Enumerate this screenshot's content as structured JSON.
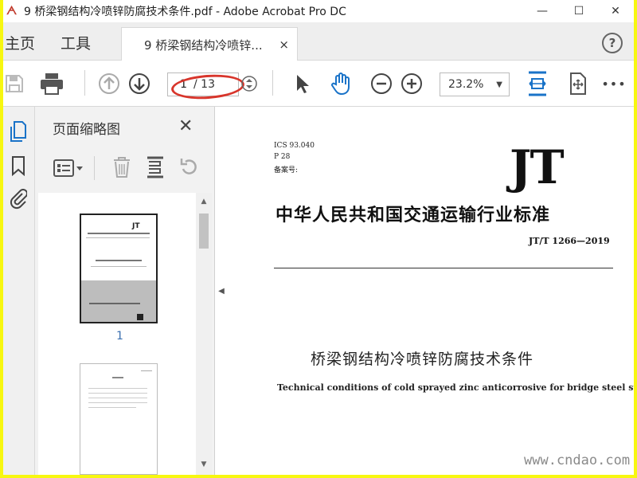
{
  "window": {
    "title": "9 桥梁钢结构冷喷锌防腐技术条件.pdf - Adobe Acrobat Pro DC",
    "minimize": "—",
    "maximize": "☐",
    "close": "✕"
  },
  "tabs": {
    "home": "主页",
    "tools": "工具",
    "document": "9 桥梁钢结构冷喷锌...",
    "close": "×",
    "help": "?"
  },
  "toolbar": {
    "page_current": "1",
    "page_total": "/ 13",
    "zoom": "23.2%",
    "more": "•••"
  },
  "panel": {
    "title": "页面缩略图",
    "close": "✕",
    "thumbnails": [
      {
        "label": "1"
      },
      {
        "label": ""
      }
    ]
  },
  "document": {
    "ics": "ICS 93.040",
    "p": "P 28",
    "record": "备案号:",
    "logo": "JT",
    "industry_title": "中华人民共和国交通运输行业标准",
    "code": "JT/T 1266—2019",
    "title_cn": "桥梁钢结构冷喷锌防腐技术条件",
    "title_en": "Technical conditions of cold sprayed zinc anticorrosive for bridge steel structure"
  },
  "watermark": "www.cndao.com",
  "colors": {
    "frame": "#f7f710",
    "annotation": "#d8352b",
    "accent": "#1a73c8"
  }
}
